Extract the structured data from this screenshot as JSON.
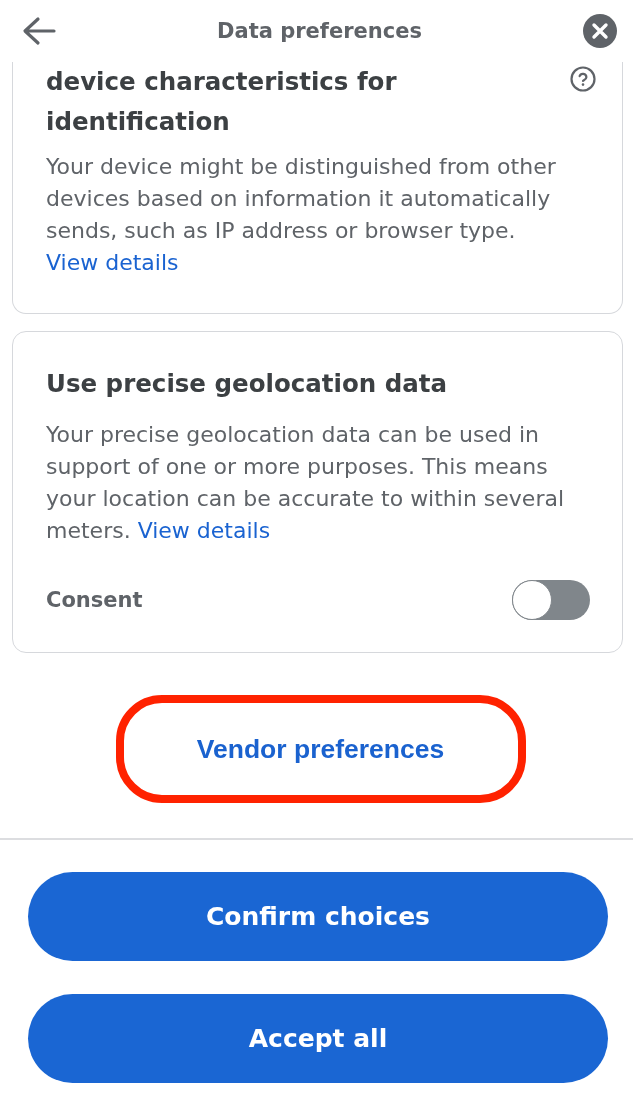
{
  "header": {
    "title": "Data preferences"
  },
  "purposes": [
    {
      "title": "device characteristics for identification",
      "cut_off_top": true,
      "help": true,
      "description": "Your device might be distinguished from other devices based on information it automatically sends, such as IP address or browser type.",
      "link": "View details"
    },
    {
      "title": "Use precise geolocation data",
      "cut_off_top": false,
      "help": false,
      "description": "Your precise geolocation data can be used in support of one or more purposes. This means your location can be accurate to within several meters.",
      "link": "View details",
      "consent": {
        "label": "Consent",
        "on": false
      }
    }
  ],
  "vendor_preferences": {
    "label": "Vendor preferences",
    "highlighted": true
  },
  "actions": [
    {
      "label": "Confirm choices"
    },
    {
      "label": "Accept all"
    }
  ]
}
